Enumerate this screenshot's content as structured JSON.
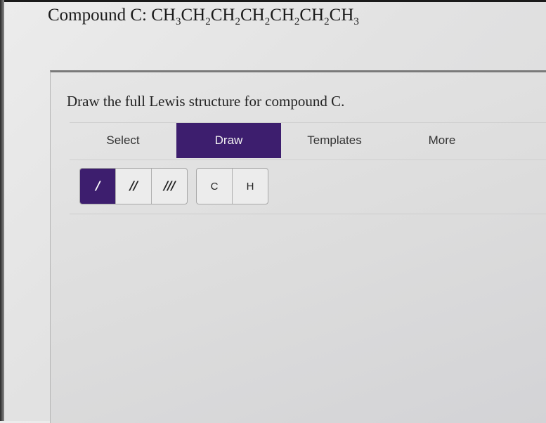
{
  "compound": {
    "label": "Compound C: ",
    "formula_parts": [
      {
        "t": "CH",
        "s": "3"
      },
      {
        "t": "CH",
        "s": "2"
      },
      {
        "t": "CH",
        "s": "2"
      },
      {
        "t": "CH",
        "s": "2"
      },
      {
        "t": "CH",
        "s": "2"
      },
      {
        "t": "CH",
        "s": "2"
      },
      {
        "t": "CH",
        "s": "3"
      }
    ]
  },
  "question": "Draw the full Lewis structure for compound C.",
  "tabs": [
    {
      "label": "Select",
      "active": false
    },
    {
      "label": "Draw",
      "active": true
    },
    {
      "label": "Templates",
      "active": false
    },
    {
      "label": "More",
      "active": false
    }
  ],
  "tools": {
    "bonds": [
      {
        "symbol": "/",
        "icon": "single-bond-icon",
        "selected": true
      },
      {
        "symbol": "//",
        "icon": "double-bond-icon",
        "selected": false
      },
      {
        "symbol": "///",
        "icon": "triple-bond-icon",
        "selected": false
      }
    ],
    "atoms": [
      {
        "symbol": "C"
      },
      {
        "symbol": "H"
      }
    ]
  },
  "colors": {
    "accent": "#3d1e6e"
  }
}
